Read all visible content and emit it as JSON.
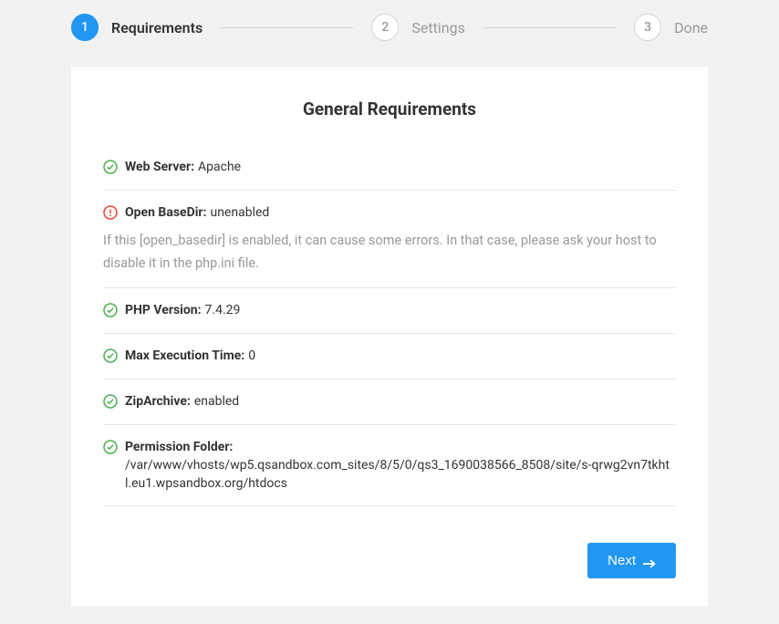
{
  "stepper": {
    "steps": [
      {
        "number": "1",
        "label": "Requirements"
      },
      {
        "number": "2",
        "label": "Settings"
      },
      {
        "number": "3",
        "label": "Done"
      }
    ]
  },
  "card": {
    "title": "General Requirements",
    "items": {
      "webserver": {
        "label": "Web Server",
        "value": "Apache",
        "status": "ok"
      },
      "openbasedir": {
        "label": "Open BaseDir",
        "value": "unenabled",
        "status": "warn",
        "note": "If this [open_basedir] is enabled, it can cause some errors. In that case, please ask your host to disable it in the php.ini file."
      },
      "php": {
        "label": "PHP Version",
        "value": "7.4.29",
        "status": "ok"
      },
      "maxexec": {
        "label": "Max Execution Time",
        "value": "0",
        "status": "ok"
      },
      "zip": {
        "label": "ZipArchive",
        "value": "enabled",
        "status": "ok"
      },
      "perm": {
        "label": "Permission Folder",
        "value": "/var/www/vhosts/wp5.qsandbox.com_sites/8/5/0/qs3_1690038566_8508/site/s-qrwg2vn7tkhtl.eu1.wpsandbox.org/htdocs",
        "status": "ok"
      }
    }
  },
  "buttons": {
    "next": "Next"
  }
}
